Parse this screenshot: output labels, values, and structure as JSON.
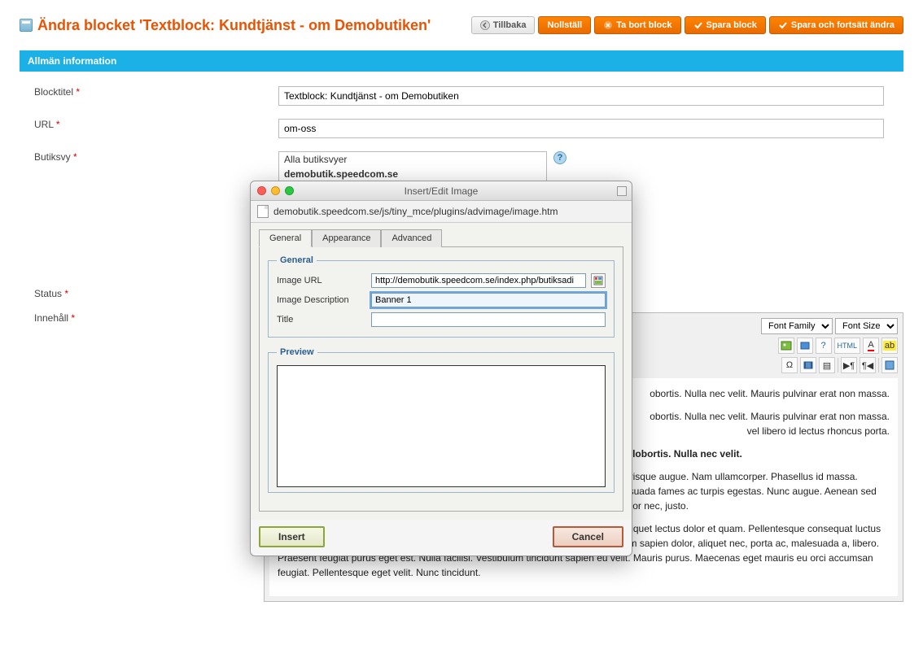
{
  "header": {
    "title": "Ändra blocket 'Textblock: Kundtjänst - om Demobutiken'",
    "buttons": {
      "back": "Tillbaka",
      "reset": "Nollställ",
      "delete": "Ta bort block",
      "save": "Spara block",
      "save_continue": "Spara och fortsätt ändra"
    }
  },
  "section": {
    "general": "Allmän information"
  },
  "form": {
    "labels": {
      "title": "Blocktitel",
      "url": "URL",
      "storeview": "Butiksvy",
      "status": "Status",
      "content": "Innehåll"
    },
    "values": {
      "title": "Textblock: Kundtjänst - om Demobutiken",
      "url": "om-oss"
    },
    "storeview": {
      "all": "Alla butiksvyer",
      "selected": "demobutik.speedcom.se"
    }
  },
  "editor": {
    "font_family": "Font Family",
    "font_size": "Font Size",
    "html_label": "HTML",
    "content": {
      "p1_tail": "obortis. Nulla nec velit. Mauris pulvinar erat non massa.",
      "p2a": "obortis. Nulla nec velit. Mauris pulvinar erat non massa.",
      "p2b": "vel libero id lectus rhoncus porta.",
      "p3": "Lorem ipsum dolor sit amet, consectetuer adipiscing elit. Morbi luctus. Duis lobortis. Nulla nec velit.",
      "p4": "Vivamus tortor nisl, lobortis in, faucibus et, tempus at, dui. Nunc risus. Proin scelerisque augue. Nam ullamcorper. Phasellus id massa. Pellentesque nisl. Pellentesque habitant morbi tristique senectus et netus et malesuada fames ac turpis egestas. Nunc augue. Aenean sed justo non leo vehicula laoreet. Praesent ipsum libero, auctor ac, tempus nec, tempor nec, justo.",
      "p5": "Maecenas ullamcorper, odio vel tempus egestas, dui orci faucibus orci, sit amet aliquet lectus dolor et quam. Pellentesque consequat luctus purus. Nunc et risus. Etiam a nibh. Phasellus dignissim metus eget nisi. Vestibulum sapien dolor, aliquet nec, porta ac, malesuada a, libero. Praesent feugiat purus eget est. Nulla facilisi. Vestibulum tincidunt sapien eu velit. Mauris purus. Maecenas eget mauris eu orci accumsan feugiat. Pellentesque eget velit. Nunc tincidunt."
    }
  },
  "modal": {
    "title": "Insert/Edit Image",
    "url": "demobutik.speedcom.se/js/tiny_mce/plugins/advimage/image.htm",
    "tabs": {
      "general": "General",
      "appearance": "Appearance",
      "advanced": "Advanced"
    },
    "fieldset": {
      "general": "General",
      "preview": "Preview"
    },
    "fields": {
      "image_url_label": "Image URL",
      "image_url_value": "http://demobutik.speedcom.se/index.php/butiksadi",
      "description_label": "Image Description",
      "description_value": "Banner 1",
      "title_label": "Title",
      "title_value": ""
    },
    "buttons": {
      "insert": "Insert",
      "cancel": "Cancel"
    }
  }
}
